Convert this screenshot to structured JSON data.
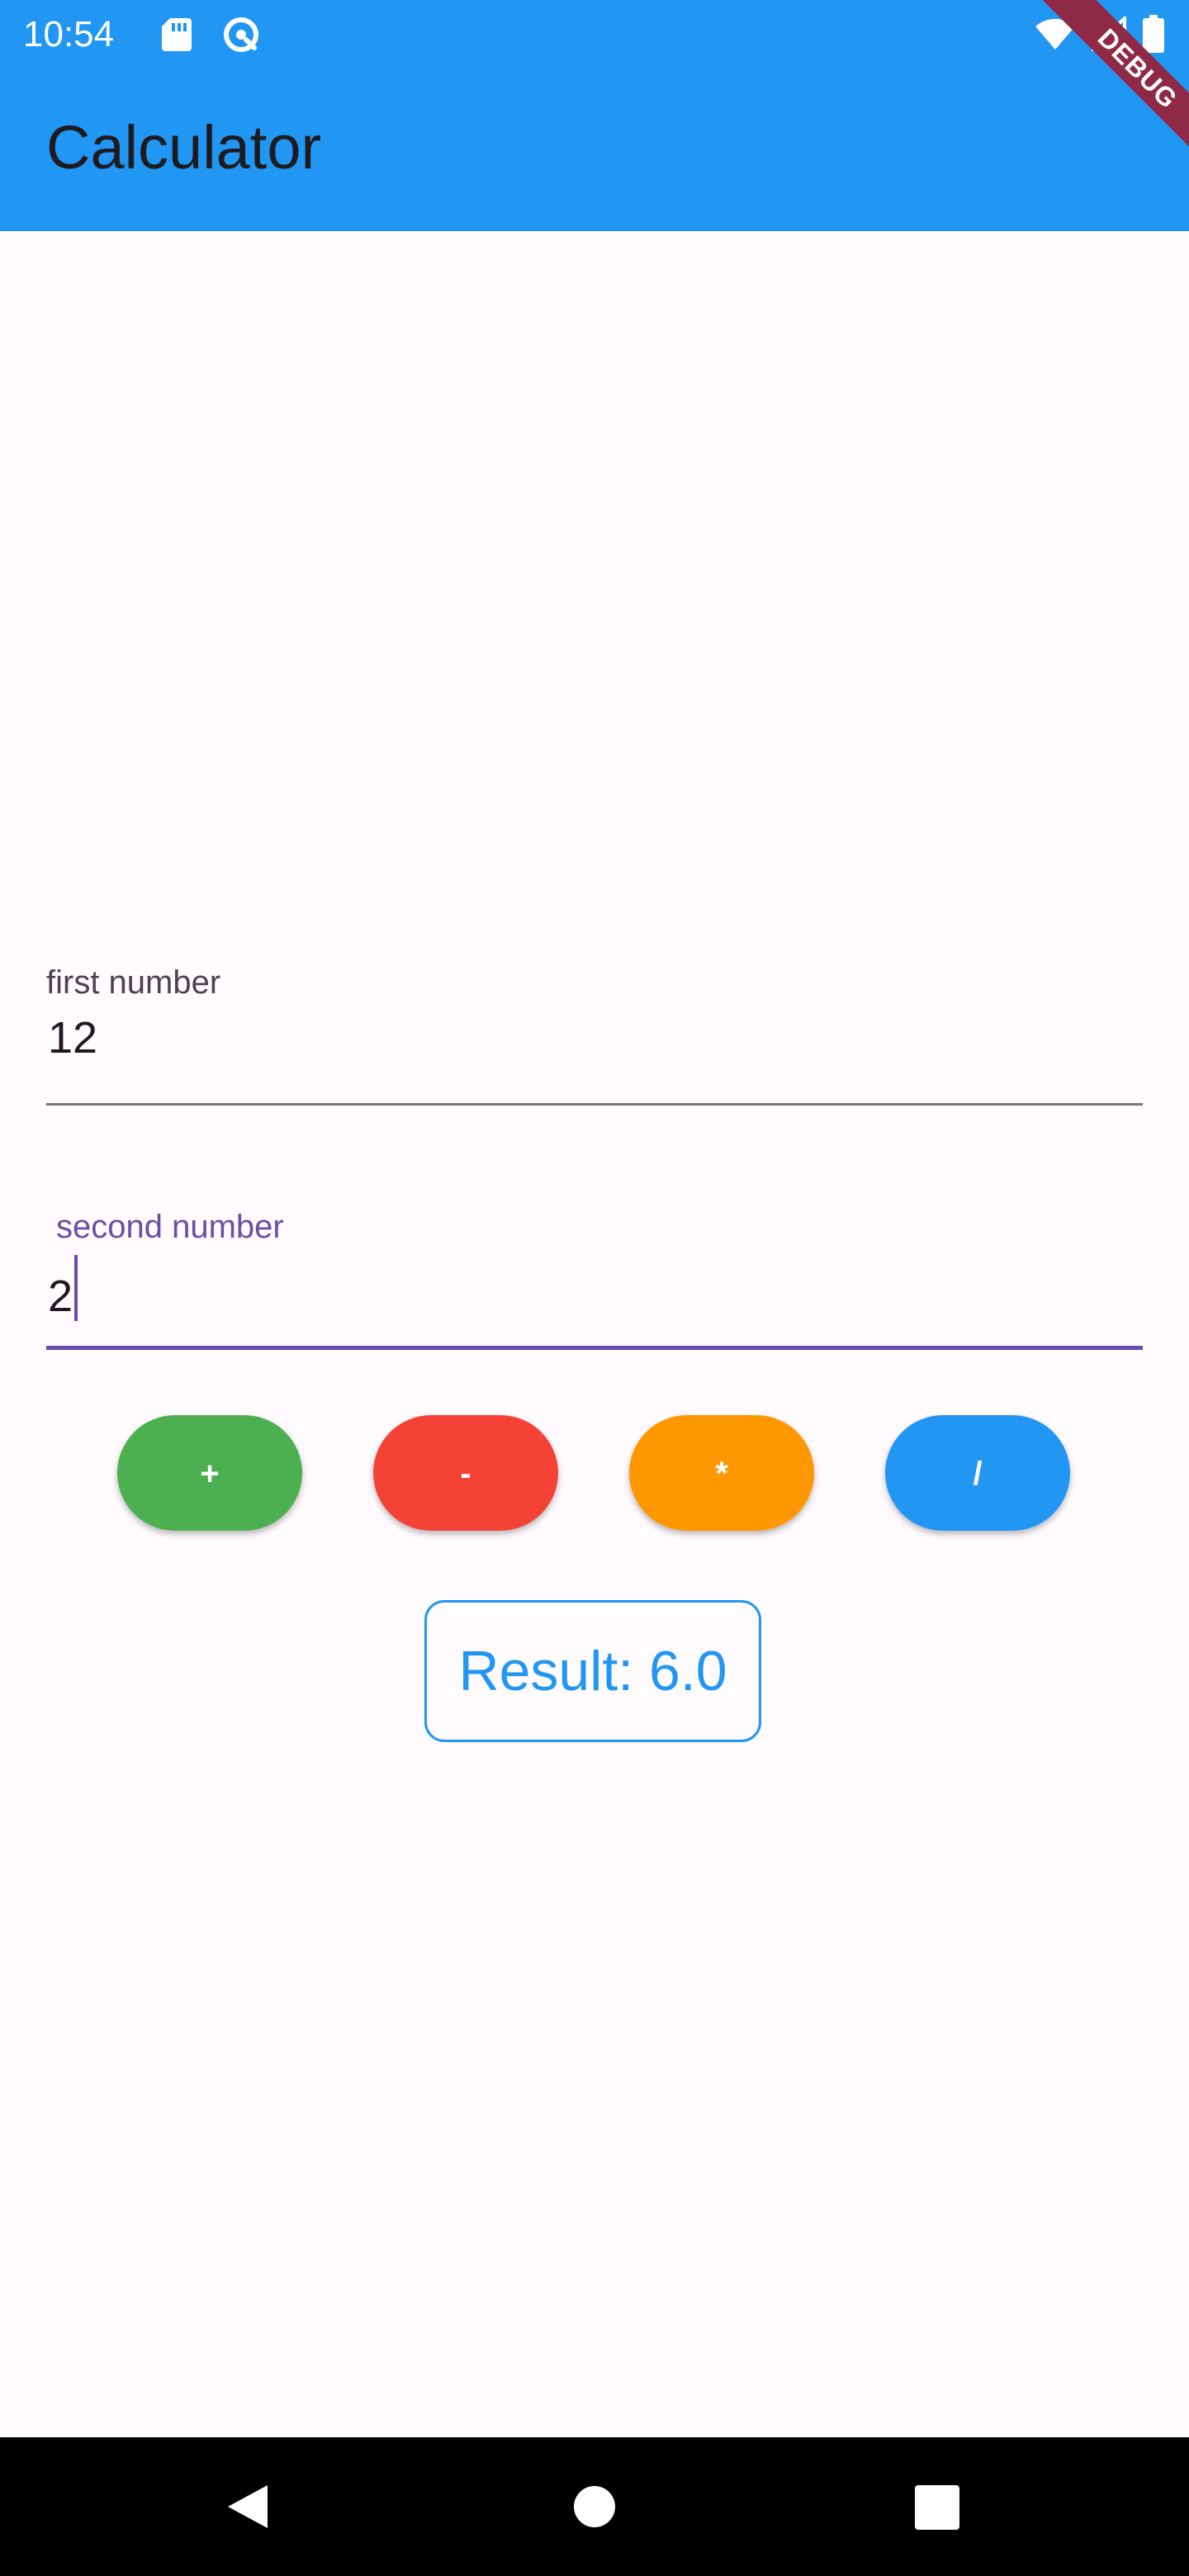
{
  "status_bar": {
    "time": "10:54",
    "icons": [
      "sd-card-icon",
      "sync-icon",
      "wifi-icon",
      "cell-signal-icon",
      "battery-icon"
    ]
  },
  "app_bar": {
    "title": "Calculator",
    "debug_banner": "DEBUG"
  },
  "form": {
    "first_number": {
      "label": "first number",
      "value": "12"
    },
    "second_number": {
      "label": "second number",
      "value": "2"
    }
  },
  "operations": [
    {
      "label": "+",
      "color": "#4CAF50"
    },
    {
      "label": "-",
      "color": "#F44336"
    },
    {
      "label": "*",
      "color": "#FF9800"
    },
    {
      "label": "/",
      "color": "#2196F3"
    }
  ],
  "result": {
    "text": "Result: 6.0"
  },
  "theme": {
    "primary": "#2196F3",
    "focus": "#6750A4",
    "background": "#FFFBFE"
  },
  "nav_bar": {
    "icons": [
      "back-icon",
      "home-icon",
      "recent-apps-icon"
    ]
  }
}
